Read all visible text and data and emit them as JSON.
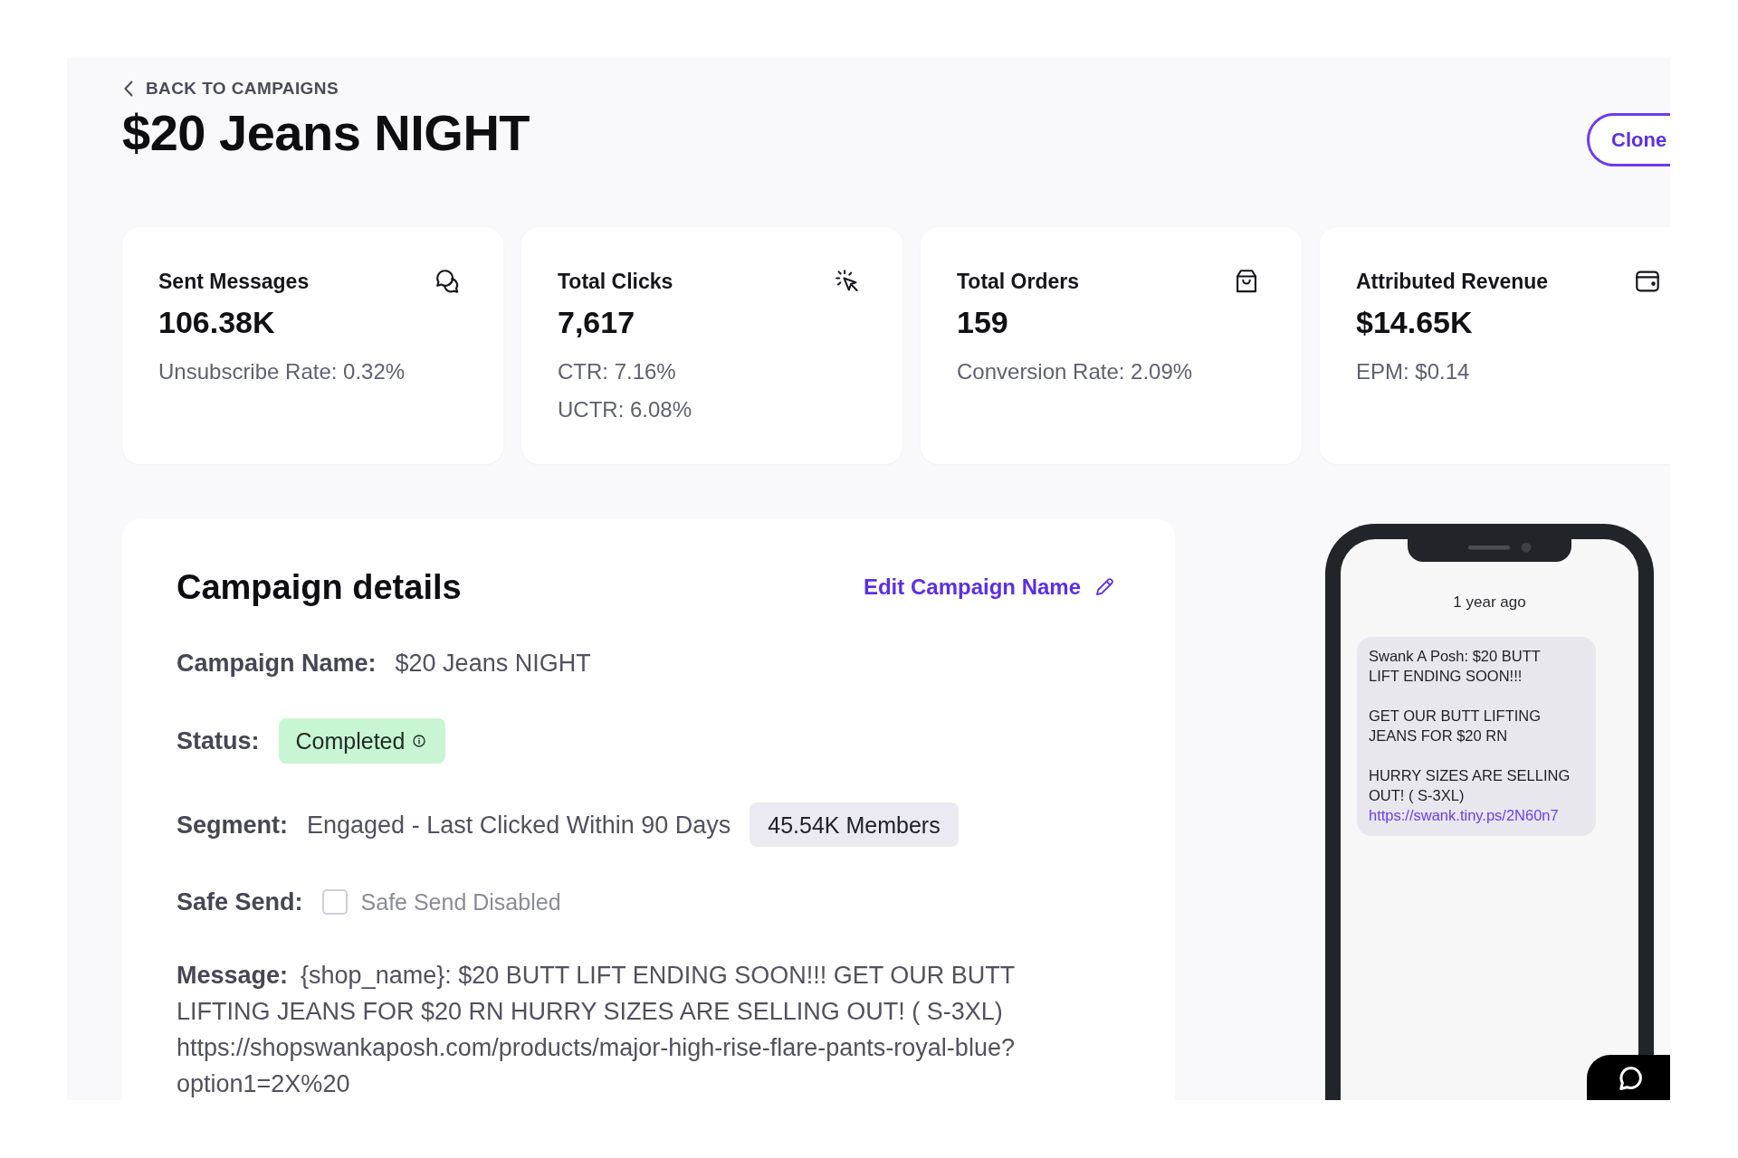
{
  "header": {
    "back_link": "BACK TO CAMPAIGNS",
    "title": "$20 Jeans NIGHT",
    "clone_button": "Clone"
  },
  "stats": [
    {
      "kind": "messages",
      "title": "Sent Messages",
      "value": "106.38K",
      "details": [
        "Unsubscribe Rate: 0.32%"
      ]
    },
    {
      "kind": "clicks",
      "title": "Total Clicks",
      "value": "7,617",
      "details": [
        "CTR: 7.16%",
        "UCTR: 6.08%"
      ]
    },
    {
      "kind": "orders",
      "title": "Total Orders",
      "value": "159",
      "details": [
        "Conversion Rate: 2.09%"
      ]
    },
    {
      "kind": "revenue",
      "title": "Attributed Revenue",
      "value": "$14.65K",
      "details": [
        "EPM: $0.14"
      ]
    }
  ],
  "campaign_details": {
    "title": "Campaign details",
    "edit_link": "Edit Campaign Name",
    "fields": [
      {
        "kind": "text",
        "label": "Campaign Name:",
        "value": "$20 Jeans NIGHT"
      },
      {
        "kind": "status",
        "label": "Status:",
        "value": "Completed"
      },
      {
        "kind": "segment",
        "label": "Segment:",
        "value": "Engaged - Last Clicked Within 90 Days",
        "badge": "45.54K Members"
      },
      {
        "kind": "checkbox",
        "label": "Safe Send:",
        "value": "Safe Send Disabled",
        "checked": false
      },
      {
        "kind": "message",
        "label": "Message:",
        "value": "{shop_name}: $20 BUTT LIFT ENDING SOON!!! GET OUR BUTT LIFTING JEANS FOR $20 RN HURRY SIZES ARE SELLING OUT! ( S-3XL) https://shopswankaposh.com/products/major-high-rise-flare-pants-royal-blue?option1=2X%20"
      }
    ]
  },
  "phone_preview": {
    "timestamp": "1 year ago",
    "paragraphs": [
      "Swank A Posh: $20 BUTT LIFT ENDING SOON!!!",
      "GET OUR BUTT LIFTING JEANS FOR $20 RN",
      "HURRY SIZES ARE SELLING OUT! ( S-3XL)"
    ],
    "link": "https://swank.tiny.ps/2N60n7"
  }
}
